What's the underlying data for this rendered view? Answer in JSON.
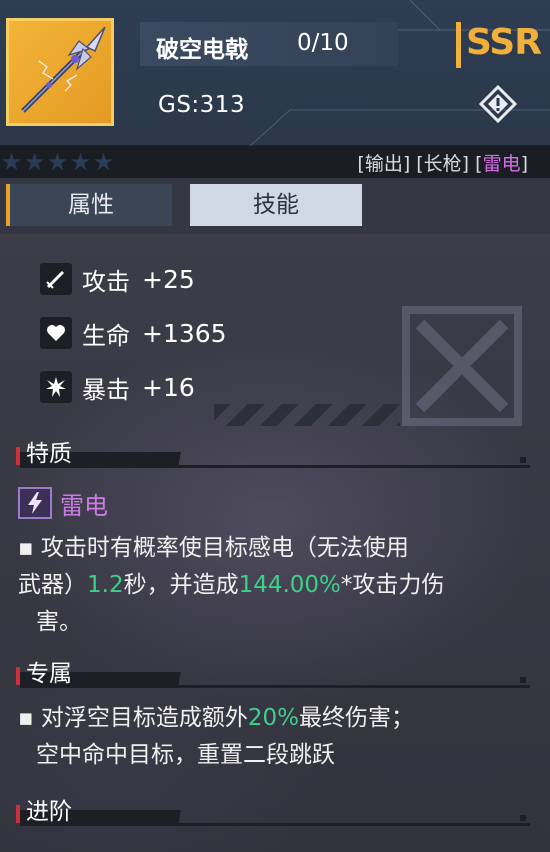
{
  "item": {
    "name": "破空电戟",
    "count": "0/10",
    "gs": "GS:313",
    "rarity": "SSR",
    "icon": "spear-icon"
  },
  "tags": {
    "part1": "[输出] [长枪] [",
    "element": "雷电",
    "part2": "]"
  },
  "stars": [
    "★",
    "★",
    "★",
    "★",
    "★"
  ],
  "tabs": {
    "attributes": "属性",
    "skills": "技能"
  },
  "stats": [
    {
      "label": "攻击",
      "value": "+25",
      "icon": "sword-icon"
    },
    {
      "label": "生命",
      "value": "+1365",
      "icon": "heart-icon"
    },
    {
      "label": "暴击",
      "value": "+16",
      "icon": "burst-icon"
    }
  ],
  "sections": {
    "traits_title": "特质",
    "trait_name": "雷电",
    "trait_desc_1": "▪ 攻击时有概率使目标感电（无法使用",
    "trait_desc_2a": "武器）",
    "trait_desc_2b": "1.2",
    "trait_desc_2c": "秒，并造成",
    "trait_desc_2d": "144.00%",
    "trait_desc_2e": "*攻击力伤",
    "trait_desc_3": "害。",
    "exclusive_title": "专属",
    "exclusive_1a": "▪ 对浮空目标造成额外",
    "exclusive_1b": "20%",
    "exclusive_1c": "最终伤害；",
    "exclusive_2": "空中命中目标，重置二段跳跃",
    "advance_title": "进阶"
  },
  "colors": {
    "rarity": "#f1b03c",
    "element": "#cc7ae5",
    "highlight": "#3fcf8a",
    "accent": "#c9313b"
  }
}
